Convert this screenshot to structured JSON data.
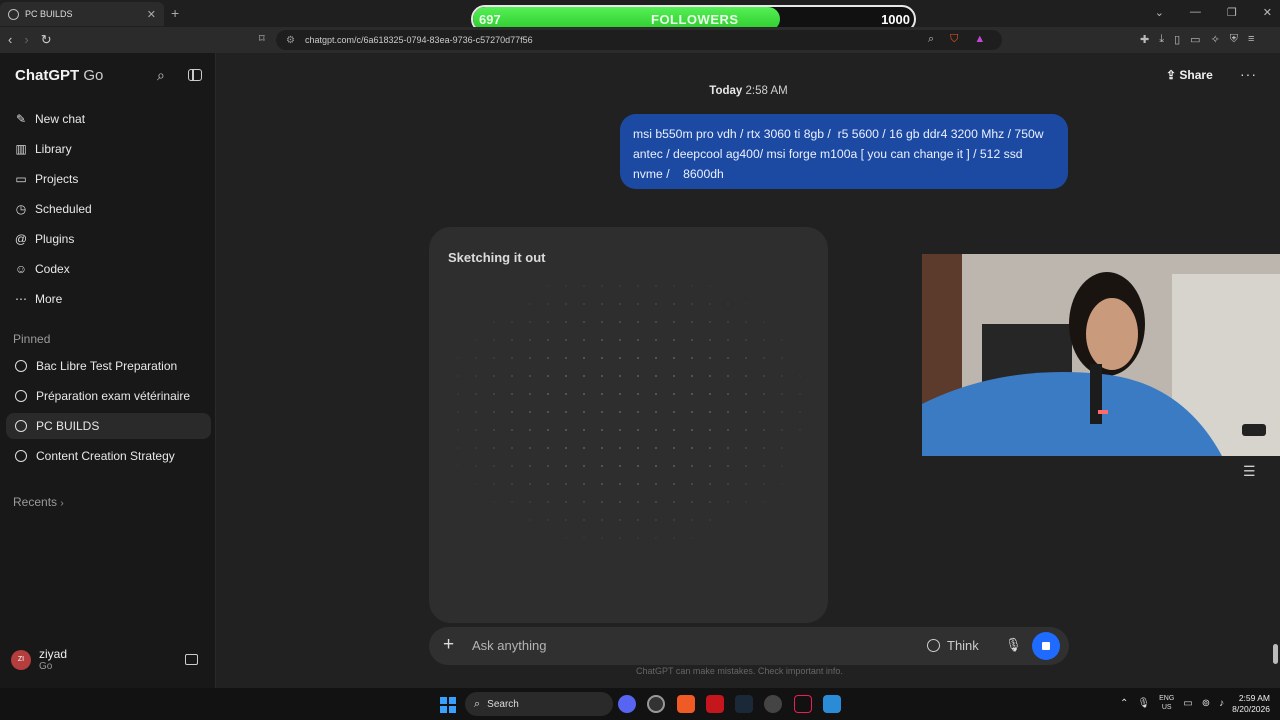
{
  "browser": {
    "tab_title": "PC BUILDS",
    "url": "chatgpt.com/c/6a618325-0794-83ea-9736-c57270d77f56"
  },
  "overlay": {
    "followers_current": "697",
    "followers_label": "FOLLOWERS",
    "followers_goal": "1000",
    "progress_fraction": 0.697
  },
  "sidebar": {
    "brand": "ChatGPT",
    "plan": "Go",
    "nav": [
      {
        "label": "New chat",
        "icon": "compose-icon"
      },
      {
        "label": "Library",
        "icon": "library-icon"
      },
      {
        "label": "Projects",
        "icon": "folder-icon"
      },
      {
        "label": "Scheduled",
        "icon": "clock-icon"
      },
      {
        "label": "Plugins",
        "icon": "plugins-icon"
      },
      {
        "label": "Codex",
        "icon": "codex-icon"
      },
      {
        "label": "More",
        "icon": "ellipsis-icon"
      }
    ],
    "pinned_label": "Pinned",
    "pinned": [
      {
        "label": "Bac Libre Test Preparation"
      },
      {
        "label": "Préparation exam vétérinaire"
      },
      {
        "label": "PC BUILDS"
      },
      {
        "label": "Content Creation Strategy"
      }
    ],
    "recents_label": "Recents",
    "user": {
      "initials": "ZI",
      "name": "ziyad",
      "plan": "Go"
    }
  },
  "header": {
    "share_label": "Share"
  },
  "conversation": {
    "day": "Today",
    "time": "2:58 AM",
    "user_message": "msi b550m pro vdh / rtx 3060 ti 8gb /  r5 5600 / 16 gb ddr4 3200 Mhz / 750w antec / deepcool ag400/ msi forge m100a [ you can change it ] / 512 ssd nvme /    8600dh",
    "assistant_status": "Sketching it out"
  },
  "composer": {
    "placeholder": "Ask anything",
    "think_label": "Think",
    "disclaimer": "ChatGPT can make mistakes. Check important info."
  },
  "taskbar": {
    "search_label": "Search",
    "lang_top": "ENG",
    "lang_bottom": "US",
    "time": "2:59 AM",
    "date": "8/20/2026"
  },
  "colors": {
    "accent_blue": "#1c4aa3",
    "stop_button": "#1f6bff",
    "followers_green": "#2cc92c"
  }
}
